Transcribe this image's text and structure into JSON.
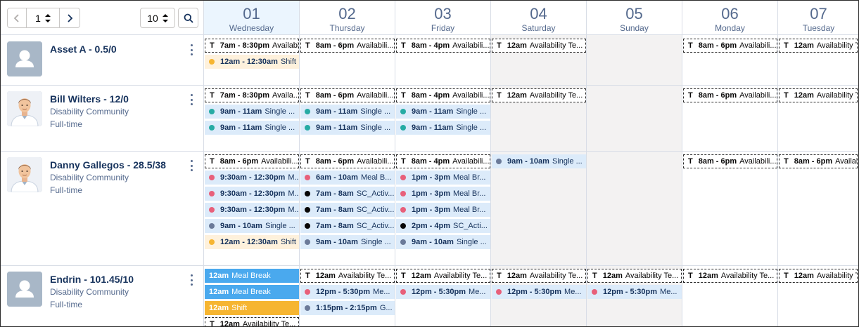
{
  "controls": {
    "page_value": "1",
    "page_size": "10",
    "prev_icon": "chevron-left-icon",
    "next_icon": "chevron-right-icon",
    "search_icon": "search-icon"
  },
  "days": [
    {
      "num": "01",
      "name": "Wednesday",
      "today": true
    },
    {
      "num": "02",
      "name": "Thursday"
    },
    {
      "num": "03",
      "name": "Friday"
    },
    {
      "num": "04",
      "name": "Saturday"
    },
    {
      "num": "05",
      "name": "Sunday"
    },
    {
      "num": "06",
      "name": "Monday"
    },
    {
      "num": "07",
      "name": "Tuesday"
    }
  ],
  "colors": {
    "teal": "#26aba4",
    "pink": "#e8607a",
    "black": "#080707",
    "slate": "#6b7a99",
    "orange": "#f6b531",
    "blue_solid": "#4aa9ee",
    "blue_light": "#dcebfa",
    "orange_light": "#fef1dc",
    "weekend": "#f3f2f2",
    "today": "#ebf5fe"
  },
  "resources": [
    {
      "name": "Asset A - 0.5/0",
      "sub1": "",
      "sub2": "",
      "avatar": "placeholder",
      "events": [
        {
          "day": 0,
          "slot": 0,
          "kind": "avail",
          "letter": "T",
          "time": "7am - 8:30pm",
          "title": "Availabili..."
        },
        {
          "day": 1,
          "slot": 0,
          "kind": "avail",
          "letter": "T",
          "time": "8am - 6pm",
          "title": "Availabili..."
        },
        {
          "day": 2,
          "slot": 0,
          "kind": "avail",
          "letter": "T",
          "time": "8am - 4pm",
          "title": "Availabili..."
        },
        {
          "day": 3,
          "slot": 0,
          "kind": "avail",
          "letter": "T",
          "time": "12am",
          "title": "Availability Te..."
        },
        {
          "day": 5,
          "slot": 0,
          "kind": "avail",
          "letter": "T",
          "time": "8am - 6pm",
          "title": "Availabili..."
        },
        {
          "day": 6,
          "slot": 0,
          "kind": "avail",
          "letter": "T",
          "time": "12am",
          "title": "Availability Te..."
        },
        {
          "day": 0,
          "slot": 1,
          "kind": "filled",
          "bg": "orange_light",
          "dot": "orange",
          "time": "12am - 12:30am",
          "title": "Shift"
        }
      ]
    },
    {
      "name": "Bill Wilters - 12/0",
      "sub1": "Disability Community",
      "sub2": "Full-time",
      "avatar": "person",
      "events": [
        {
          "day": 0,
          "slot": 0,
          "kind": "avail",
          "letter": "T",
          "time": "7am - 8:30pm",
          "title": "Availa..."
        },
        {
          "day": 1,
          "slot": 0,
          "kind": "avail",
          "letter": "T",
          "time": "8am - 6pm",
          "title": "Availabili..."
        },
        {
          "day": 2,
          "slot": 0,
          "kind": "avail",
          "letter": "T",
          "time": "8am - 4pm",
          "title": "Availabili..."
        },
        {
          "day": 3,
          "slot": 0,
          "kind": "avail",
          "letter": "T",
          "time": "12am",
          "title": "Availability Te..."
        },
        {
          "day": 5,
          "slot": 0,
          "kind": "avail",
          "letter": "T",
          "time": "8am - 6pm",
          "title": "Availabili..."
        },
        {
          "day": 6,
          "slot": 0,
          "kind": "avail",
          "letter": "T",
          "time": "12am",
          "title": "Availability Te..."
        },
        {
          "day": 0,
          "slot": 1,
          "kind": "filled",
          "bg": "blue_light",
          "dot": "teal",
          "time": "9am - 11am",
          "title": "Single ..."
        },
        {
          "day": 1,
          "slot": 1,
          "kind": "filled",
          "bg": "blue_light",
          "dot": "teal",
          "time": "9am - 11am",
          "title": "Single ..."
        },
        {
          "day": 2,
          "slot": 1,
          "kind": "filled",
          "bg": "blue_light",
          "dot": "teal",
          "time": "9am - 11am",
          "title": "Single ..."
        },
        {
          "day": 0,
          "slot": 2,
          "kind": "filled",
          "bg": "blue_light",
          "dot": "teal",
          "time": "9am - 11am",
          "title": "Single ..."
        },
        {
          "day": 1,
          "slot": 2,
          "kind": "filled",
          "bg": "blue_light",
          "dot": "teal",
          "time": "9am - 11am",
          "title": "Single ..."
        },
        {
          "day": 2,
          "slot": 2,
          "kind": "filled",
          "bg": "blue_light",
          "dot": "teal",
          "time": "9am - 11am",
          "title": "Single ..."
        }
      ]
    },
    {
      "name": "Danny Gallegos - 28.5/38",
      "sub1": "Disability Community",
      "sub2": "Full-time",
      "avatar": "person",
      "events": [
        {
          "day": 0,
          "slot": 0,
          "kind": "avail",
          "letter": "T",
          "time": "8am - 6pm",
          "title": "Availabili..."
        },
        {
          "day": 1,
          "slot": 0,
          "kind": "avail",
          "letter": "T",
          "time": "8am - 6pm",
          "title": "Availabili..."
        },
        {
          "day": 2,
          "slot": 0,
          "kind": "avail",
          "letter": "T",
          "time": "8am - 4pm",
          "title": "Availabili..."
        },
        {
          "day": 3,
          "slot": 0,
          "kind": "filled",
          "bg": "blue_light",
          "dot": "slate",
          "time": "9am - 10am",
          "title": "Single ..."
        },
        {
          "day": 5,
          "slot": 0,
          "kind": "avail",
          "letter": "T",
          "time": "8am - 6pm",
          "title": "Availabili..."
        },
        {
          "day": 6,
          "slot": 0,
          "kind": "avail",
          "letter": "T",
          "time": "8am - 6pm",
          "title": "Availabili..."
        },
        {
          "day": 0,
          "slot": 1,
          "kind": "filled",
          "bg": "blue_light",
          "dot": "pink",
          "time": "9:30am - 12:30pm",
          "title": "M..."
        },
        {
          "day": 1,
          "slot": 1,
          "kind": "filled",
          "bg": "blue_light",
          "dot": "pink",
          "time": "6am - 10am",
          "title": "Meal B..."
        },
        {
          "day": 2,
          "slot": 1,
          "kind": "filled",
          "bg": "blue_light",
          "dot": "pink",
          "time": "1pm - 3pm",
          "title": "Meal Br..."
        },
        {
          "day": 0,
          "slot": 2,
          "kind": "filled",
          "bg": "blue_light",
          "dot": "pink",
          "time": "9:30am - 12:30pm",
          "title": "M..."
        },
        {
          "day": 1,
          "slot": 2,
          "kind": "filled",
          "bg": "blue_light",
          "dot": "black",
          "time": "7am - 8am",
          "title": "SC_Activ..."
        },
        {
          "day": 2,
          "slot": 2,
          "kind": "filled",
          "bg": "blue_light",
          "dot": "pink",
          "time": "1pm - 3pm",
          "title": "Meal Br..."
        },
        {
          "day": 0,
          "slot": 3,
          "kind": "filled",
          "bg": "blue_light",
          "dot": "pink",
          "time": "9:30am - 12:30pm",
          "title": "M..."
        },
        {
          "day": 1,
          "slot": 3,
          "kind": "filled",
          "bg": "blue_light",
          "dot": "black",
          "time": "7am - 8am",
          "title": "SC_Activ..."
        },
        {
          "day": 2,
          "slot": 3,
          "kind": "filled",
          "bg": "blue_light",
          "dot": "pink",
          "time": "1pm - 3pm",
          "title": "Meal Br..."
        },
        {
          "day": 0,
          "slot": 4,
          "kind": "filled",
          "bg": "blue_light",
          "dot": "slate",
          "time": "9am - 10am",
          "title": "Single ..."
        },
        {
          "day": 1,
          "slot": 4,
          "kind": "filled",
          "bg": "blue_light",
          "dot": "black",
          "time": "7am - 8am",
          "title": "SC_Activ..."
        },
        {
          "day": 2,
          "slot": 4,
          "kind": "filled",
          "bg": "blue_light",
          "dot": "black",
          "time": "2pm - 4pm",
          "title": "SC_Acti..."
        },
        {
          "day": 0,
          "slot": 5,
          "kind": "filled",
          "bg": "orange_light",
          "dot": "orange",
          "time": "12am - 12:30am",
          "title": "Shift"
        },
        {
          "day": 1,
          "slot": 5,
          "kind": "filled",
          "bg": "blue_light",
          "dot": "slate",
          "time": "9am - 10am",
          "title": "Single ..."
        },
        {
          "day": 2,
          "slot": 5,
          "kind": "filled",
          "bg": "blue_light",
          "dot": "slate",
          "time": "9am - 10am",
          "title": "Single ..."
        }
      ]
    },
    {
      "name": "Endrin - 101.45/10",
      "sub1": "Disability Community",
      "sub2": "Full-time",
      "avatar": "placeholder",
      "events": [
        {
          "day": 0,
          "slot": 0,
          "kind": "solid",
          "bg": "blue_solid",
          "time": "12am",
          "title": "Meal Break"
        },
        {
          "day": 1,
          "slot": 0,
          "kind": "avail",
          "letter": "T",
          "time": "12am",
          "title": "Availability Te..."
        },
        {
          "day": 2,
          "slot": 0,
          "kind": "avail",
          "letter": "T",
          "time": "12am",
          "title": "Availability Te..."
        },
        {
          "day": 3,
          "slot": 0,
          "kind": "avail",
          "letter": "T",
          "time": "12am",
          "title": "Availability Te..."
        },
        {
          "day": 4,
          "slot": 0,
          "kind": "avail",
          "letter": "T",
          "time": "12am",
          "title": "Availability Te..."
        },
        {
          "day": 5,
          "slot": 0,
          "kind": "avail",
          "letter": "T",
          "time": "12am",
          "title": "Availability Te..."
        },
        {
          "day": 6,
          "slot": 0,
          "kind": "avail",
          "letter": "T",
          "time": "12am",
          "title": "Availability Te..."
        },
        {
          "day": 0,
          "slot": 1,
          "kind": "solid",
          "bg": "blue_solid",
          "time": "12am",
          "title": "Meal Break"
        },
        {
          "day": 1,
          "slot": 1,
          "kind": "filled",
          "bg": "blue_light",
          "dot": "pink",
          "time": "12pm - 5:30pm",
          "title": "Me..."
        },
        {
          "day": 2,
          "slot": 1,
          "kind": "filled",
          "bg": "blue_light",
          "dot": "pink",
          "time": "12pm - 5:30pm",
          "title": "Me..."
        },
        {
          "day": 3,
          "slot": 1,
          "kind": "filled",
          "bg": "blue_light",
          "dot": "pink",
          "time": "12pm - 5:30pm",
          "title": "Me..."
        },
        {
          "day": 4,
          "slot": 1,
          "kind": "filled",
          "bg": "blue_light",
          "dot": "pink",
          "time": "12pm - 5:30pm",
          "title": "Me..."
        },
        {
          "day": 0,
          "slot": 2,
          "kind": "solid",
          "bg": "orange",
          "time": "12am",
          "title": "Shift"
        },
        {
          "day": 1,
          "slot": 2,
          "kind": "filled",
          "bg": "blue_light",
          "dot": "slate",
          "time": "1:15pm - 2:15pm",
          "title": "G..."
        },
        {
          "day": 0,
          "slot": 3,
          "kind": "avail",
          "letter": "T",
          "time": "12am",
          "title": "Availability Te..."
        }
      ]
    }
  ]
}
